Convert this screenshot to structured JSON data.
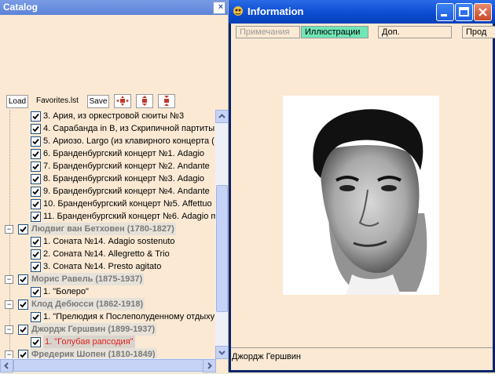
{
  "catalog": {
    "title": "Catalog",
    "close_glyph": "×",
    "toolbar": {
      "load_label": "Load",
      "file_label": "Favorites.lst",
      "save_label": "Save",
      "icons": [
        "move-all-icon",
        "move-vertical-icon",
        "collapse-vertical-icon"
      ]
    },
    "tree": [
      {
        "kind": "item",
        "label": "3. Ария, из оркестровой сюиты №3"
      },
      {
        "kind": "item",
        "label": "4. Сарабанда in B, из Скрипичной партиты №"
      },
      {
        "kind": "item",
        "label": "5. Ариозо. Largo (из клавирного концерта ("
      },
      {
        "kind": "item",
        "label": "6. Бранденбургский концерт №1. Adagio"
      },
      {
        "kind": "item",
        "label": "7. Бранденбургский концерт №2. Andante"
      },
      {
        "kind": "item",
        "label": "8. Бранденбургский концерт №3. Adagio"
      },
      {
        "kind": "item",
        "label": "9. Бранденбургский концерт №4. Andante"
      },
      {
        "kind": "item",
        "label": "10. Бранденбургский концерт №5. Affettuo"
      },
      {
        "kind": "item",
        "label": "11. Бранденбургский концерт №6. Adagio m"
      },
      {
        "kind": "group",
        "label": "Людвиг ван Бетховен (1780-1827)"
      },
      {
        "kind": "item",
        "label": "1. Соната №14. Adagio sostenuto"
      },
      {
        "kind": "item",
        "label": "2. Соната №14. Allegretto & Trio"
      },
      {
        "kind": "item",
        "label": "3. Соната №14. Presto agitato"
      },
      {
        "kind": "group",
        "label": "Морис Равель (1875-1937)"
      },
      {
        "kind": "item",
        "label": "1. \"Болеро\""
      },
      {
        "kind": "group",
        "label": "Клод Дебюсси (1862-1918)"
      },
      {
        "kind": "item",
        "label": "1. \"Прелюдия к Послеполуденному отдыху"
      },
      {
        "kind": "group",
        "label": "Джордж Гершвин (1899-1937)"
      },
      {
        "kind": "item",
        "label": "1. \"Голубая рапсодия\"",
        "selected": true
      },
      {
        "kind": "group",
        "label": "Фредерик Шопен (1810-1849)"
      }
    ]
  },
  "info": {
    "title": "Information",
    "tabs": [
      {
        "label": "Примечания",
        "state": "inactive"
      },
      {
        "label": "Иллюстрации",
        "state": "active"
      },
      {
        "label": "Доп. информация",
        "state": "normal"
      },
      {
        "label": "Прод",
        "state": "normal"
      }
    ],
    "caption": "Джордж Гершвин",
    "colors": {
      "title_bar": "#0a4bd0",
      "pane_bg": "#fbe9d4",
      "active_tab": "#6fe6b4",
      "selected_text": "#e02020"
    }
  }
}
